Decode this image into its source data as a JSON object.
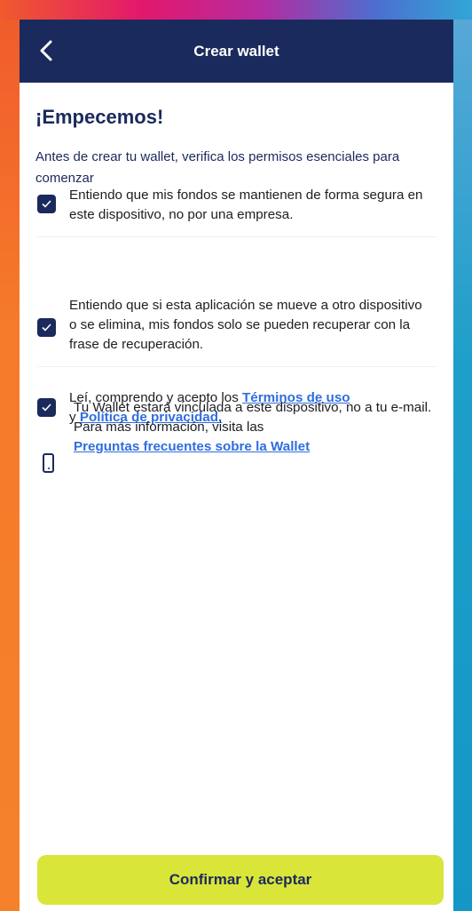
{
  "header": {
    "title": "Crear wallet"
  },
  "main": {
    "heading": "¡Empecemos!",
    "intro": "Antes de crear tu wallet, verifica los permisos esenciales para comenzar",
    "checkboxes": [
      {
        "text": "Entiendo que mis fondos se mantienen de forma segura en este dispositivo, no por una empresa.",
        "checked": true
      },
      {
        "text": "Entiendo que si esta aplicación se mueve a otro dispositivo o se elimina, mis fondos solo se pueden recuperar con la frase de recuperación.",
        "checked": true
      },
      {
        "prefix": "Leí, comprendo y acepto los ",
        "link1": "Términos de uso",
        "middle": "y ",
        "link2": "Política de privacidad.",
        "checked": true
      }
    ],
    "info": {
      "text": "Tu Wallet estará vinculada a este dispositivo, no a tu e-mail. Para más información, visita las",
      "link": "Preguntas frecuentes sobre la Wallet"
    }
  },
  "footer": {
    "confirm_label": "Confirmar y aceptar"
  },
  "colors": {
    "navy": "#1b2a5c",
    "link": "#2f6de0",
    "accent": "#d9e639"
  }
}
